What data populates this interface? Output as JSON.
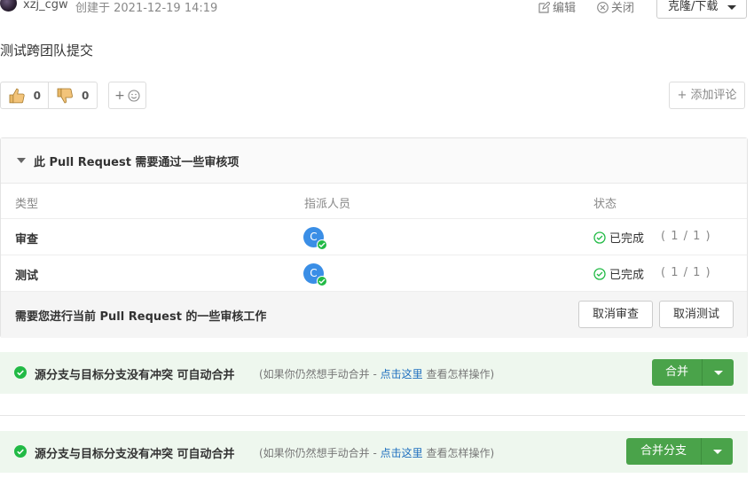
{
  "header": {
    "author": "xzj_cgw",
    "created": "创建于 2021-12-19 14:19",
    "edit_label": "编辑",
    "close_label": "关闭",
    "clone_label": "克隆/下载"
  },
  "description": "测试跨团队提交",
  "reactions": {
    "thumbs_up_count": "0",
    "thumbs_down_count": "0",
    "emoji_label": "+"
  },
  "add_comment_label": "+ 添加评论",
  "review_panel": {
    "title": "此 Pull Request 需要通过一些审核项",
    "columns": {
      "type": "类型",
      "assignee": "指派人员",
      "status": "状态"
    },
    "rows": [
      {
        "type": "审查",
        "avatar_letter": "C",
        "status": "已完成",
        "progress": "( 1 / 1 )"
      },
      {
        "type": "测试",
        "avatar_letter": "C",
        "status": "已完成",
        "progress": "( 1 / 1 )"
      }
    ],
    "footer_text": "需要您进行当前 Pull Request 的一些审核工作",
    "cancel_review_label": "取消审查",
    "cancel_test_label": "取消测试"
  },
  "merge_bars": [
    {
      "message": "源分支与目标分支没有冲突 可自动合并",
      "hint_prefix": "(如果你仍然想手动合并 - ",
      "hint_link": "点击这里",
      "hint_suffix": " 查看怎样操作)",
      "button_label": "合并"
    },
    {
      "message": "源分支与目标分支没有冲突 可自动合并",
      "hint_prefix": "(如果你仍然想手动合并 - ",
      "hint_link": "点击这里",
      "hint_suffix": " 查看怎样操作)",
      "button_label": "合并分支"
    }
  ],
  "colors": {
    "success_green": "#21ba45",
    "merge_button": "#4aa34a",
    "avatar_blue": "#3a8ee6",
    "link_blue": "#1e6fbf"
  },
  "icons": [
    "edit-icon",
    "close-circle-icon",
    "thumbs-up-icon",
    "thumbs-down-icon",
    "smile-icon",
    "check-circle-icon"
  ]
}
